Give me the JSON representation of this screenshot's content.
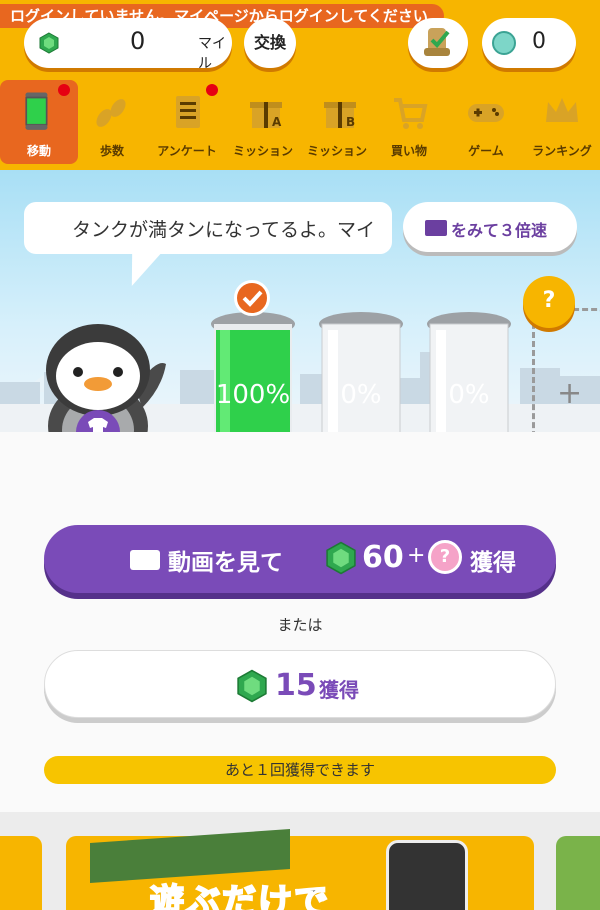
{
  "login_banner": "ログインしていません。マイページからログインしてください",
  "header": {
    "miles_value": "0",
    "miles_unit": "マイル",
    "exchange_label": "交換",
    "coin_value": "0"
  },
  "nav": {
    "items": [
      {
        "label": "移動",
        "icon": "tank-icon",
        "active": true,
        "badge": true
      },
      {
        "label": "歩数",
        "icon": "footsteps-icon",
        "active": false,
        "badge": false
      },
      {
        "label": "アンケート",
        "icon": "survey-icon",
        "active": false,
        "badge": true
      },
      {
        "label": "ミッション",
        "icon": "gift-a-icon",
        "active": false,
        "badge": false
      },
      {
        "label": "ミッション",
        "icon": "gift-b-icon",
        "active": false,
        "badge": false
      },
      {
        "label": "買い物",
        "icon": "cart-icon",
        "active": false,
        "badge": false
      },
      {
        "label": "ゲーム",
        "icon": "gamepad-icon",
        "active": false,
        "badge": false
      },
      {
        "label": "ランキング",
        "icon": "crown-icon",
        "active": false,
        "badge": false
      }
    ]
  },
  "scene": {
    "speech": "タンクが満タンになってるよ。マイ",
    "triple_button": "をみて３倍速",
    "tanks": [
      {
        "label": "100%",
        "fill": 1.0,
        "checked": true
      },
      {
        "label": "0%",
        "fill": 0.0,
        "checked": false
      },
      {
        "label": "0%",
        "fill": 0.0,
        "checked": false
      }
    ],
    "mystery_badge": "?",
    "add_slot": "+"
  },
  "actions": {
    "watch_prefix": "動画を見て",
    "watch_amount": "60",
    "watch_plus": "+",
    "watch_q": "?",
    "watch_suffix": "獲得",
    "or_text": "または",
    "earn_amount": "15",
    "earn_suffix": "獲得",
    "remaining": "あと１回獲得できます"
  },
  "banner": {
    "title": "遊ぶだけで"
  },
  "colors": {
    "brand_yellow": "#f7b500",
    "accent_orange": "#e8671f",
    "purple": "#7a4bb8",
    "gem_green": "#2fa84f"
  }
}
